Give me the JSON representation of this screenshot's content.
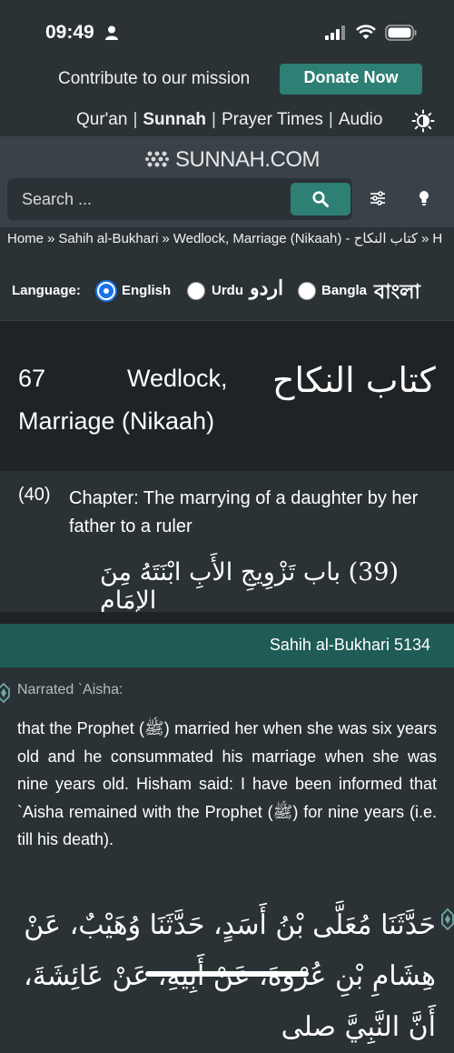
{
  "status": {
    "time": "09:49"
  },
  "contribute": {
    "text": "Contribute to our mission",
    "donate_label": "Donate Now"
  },
  "topnav": {
    "items": [
      "Qur'an",
      "Sunnah",
      "Prayer Times",
      "Audio"
    ],
    "separator": "|",
    "active": "Sunnah"
  },
  "brand": {
    "name": "SUNNAH.COM"
  },
  "search": {
    "placeholder": "Search ..."
  },
  "breadcrumb": {
    "items": [
      "Home",
      "Sahih al-Bukhari",
      "Wedlock, Marriage (Nikaah) - كتاب النكاح",
      "H"
    ],
    "sep": "»"
  },
  "language": {
    "label": "Language:",
    "options": [
      {
        "label": "English",
        "native": "",
        "selected": true
      },
      {
        "label": "Urdu",
        "native": "اردو",
        "selected": false
      },
      {
        "label": "Bangla",
        "native": "বাংলা",
        "selected": false
      }
    ]
  },
  "book": {
    "number": "67",
    "title_en_line1": "Wedlock,",
    "title_en_line2": "Marriage (Nikaah)",
    "title_ar": "كتاب النكاح"
  },
  "chapter": {
    "number": "(40)",
    "title_en": "Chapter: The marrying of a daughter by her father to a ruler",
    "title_ar": "(39) باب تَزْوِيجِ الأَبِ ابْنَتَهُ مِنَ الإِمَامِ"
  },
  "hadith": {
    "reference": "Sahih al-Bukhari 5134",
    "narrated": "Narrated `Aisha:",
    "text": "that the Prophet (ﷺ) married her when she was six years old and he consummated his marriage when she was nine years old. Hisham said: I have been informed that `Aisha remained with the Prophet (ﷺ) for nine years (i.e. till his death).",
    "arabic": "حَدَّثَنَا مُعَلَّى بْنُ أَسَدٍ، حَدَّثَنَا وُهَيْبٌ، عَنْ هِشَامِ بْنِ عُرْوَةَ، عَنْ أَبِيهِ، عَنْ عَائِشَةَ، أَنَّ النَّبِيَّ صلى"
  },
  "colors": {
    "background": "#2b3236",
    "accent": "#2e7f74",
    "hadith_bar": "#1e5c55",
    "header_dark": "#1f2326"
  }
}
